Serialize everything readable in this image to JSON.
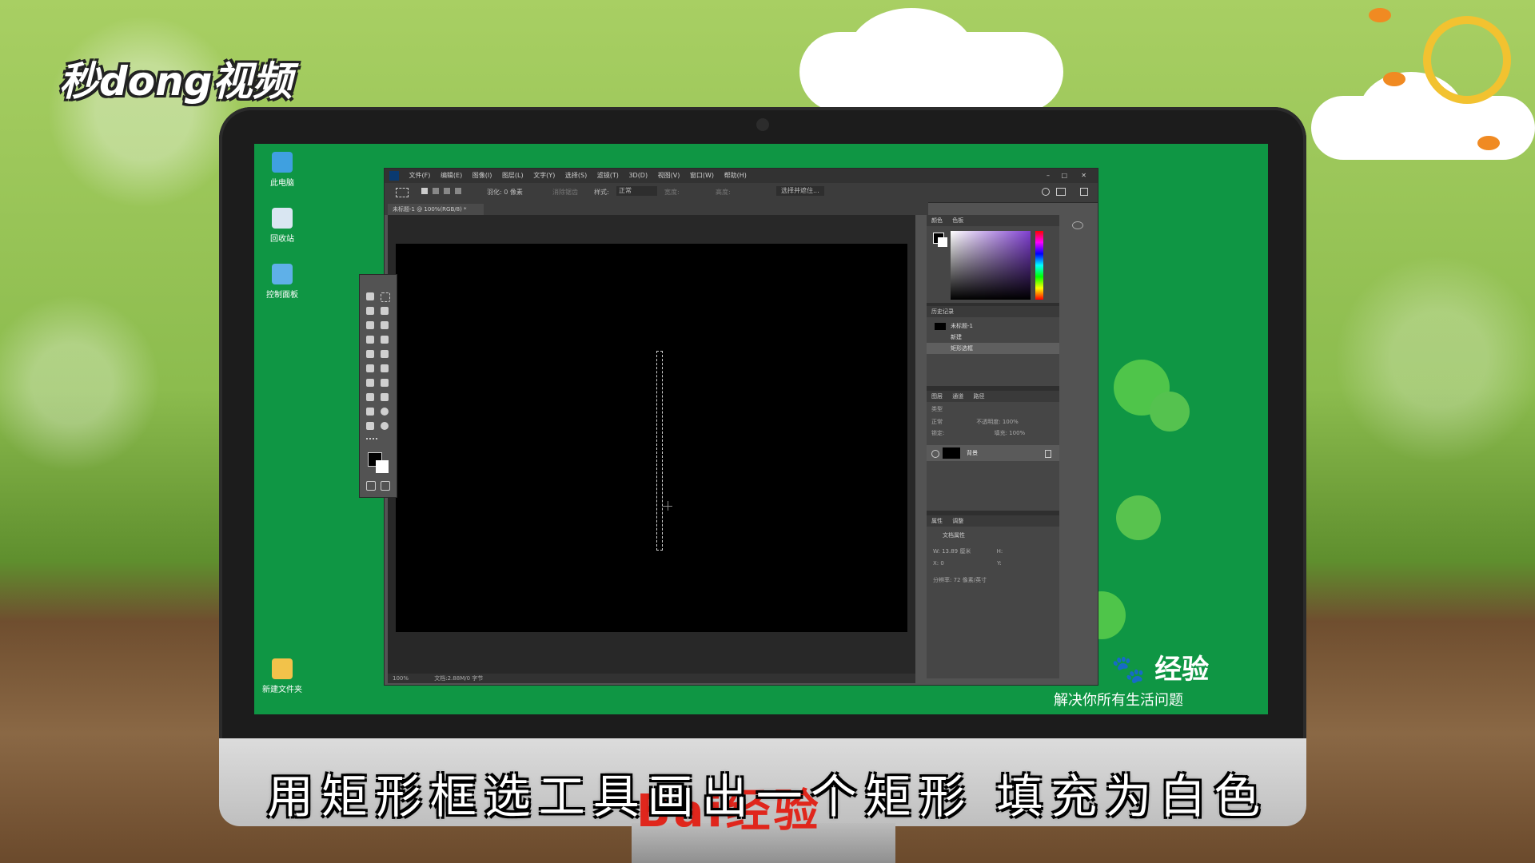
{
  "branding": {
    "logo": "秒dong视频",
    "baidu_brand": "经验",
    "baidu_slogan": "解决你所有生活问题",
    "chin_brand": "Bai经验"
  },
  "caption": "用矩形框选工具画出一个矩形 填充为白色",
  "desktop": {
    "icons": [
      {
        "label": "此电脑",
        "icon": "computer-icon"
      },
      {
        "label": "回收站",
        "icon": "recycle-bin-icon"
      },
      {
        "label": "控制面板",
        "icon": "control-panel-icon"
      },
      {
        "label": "新建文件夹",
        "icon": "folder-icon"
      }
    ]
  },
  "photoshop": {
    "menu": [
      "文件(F)",
      "编辑(E)",
      "图像(I)",
      "图层(L)",
      "文字(Y)",
      "选择(S)",
      "滤镜(T)",
      "3D(D)",
      "视图(V)",
      "窗口(W)",
      "帮助(H)"
    ],
    "options": {
      "feather": "羽化: 0 像素",
      "antialias": "消除锯齿",
      "style_label": "样式:",
      "style_value": "正常",
      "width_label": "宽度:",
      "height_label": "高度:",
      "select_mask": "选择并遮住..."
    },
    "document_tab": "未标题-1 @ 100%(RGB/8) *",
    "status": {
      "zoom": "100%",
      "doc": "文档:2.88M/0 字节"
    },
    "panels": {
      "color_tabs": [
        "颜色",
        "色板"
      ],
      "history_tab": "历史记录",
      "history_items": [
        "未标题-1",
        "新建",
        "矩形选框"
      ],
      "layers_tabs": [
        "图层",
        "通道",
        "路径"
      ],
      "layer_kind": "类型",
      "blend_mode": "正常",
      "opacity": "不透明度: 100%",
      "lock_label": "锁定:",
      "fill": "填充: 100%",
      "layer_name": "背景",
      "props_tabs": [
        "属性",
        "调整"
      ],
      "doc_props": "文档属性",
      "w_label": "W: 13.89 厘米",
      "h_label": "H:",
      "x_label": "X: 0",
      "y_label": "Y:",
      "resolution": "分辨率: 72 像素/英寸"
    },
    "window_controls": [
      "–",
      "□",
      "✕"
    ]
  },
  "colors": {
    "desktop": "#0f9644",
    "ps_bg": "#535353",
    "caption": "#ffffff"
  }
}
